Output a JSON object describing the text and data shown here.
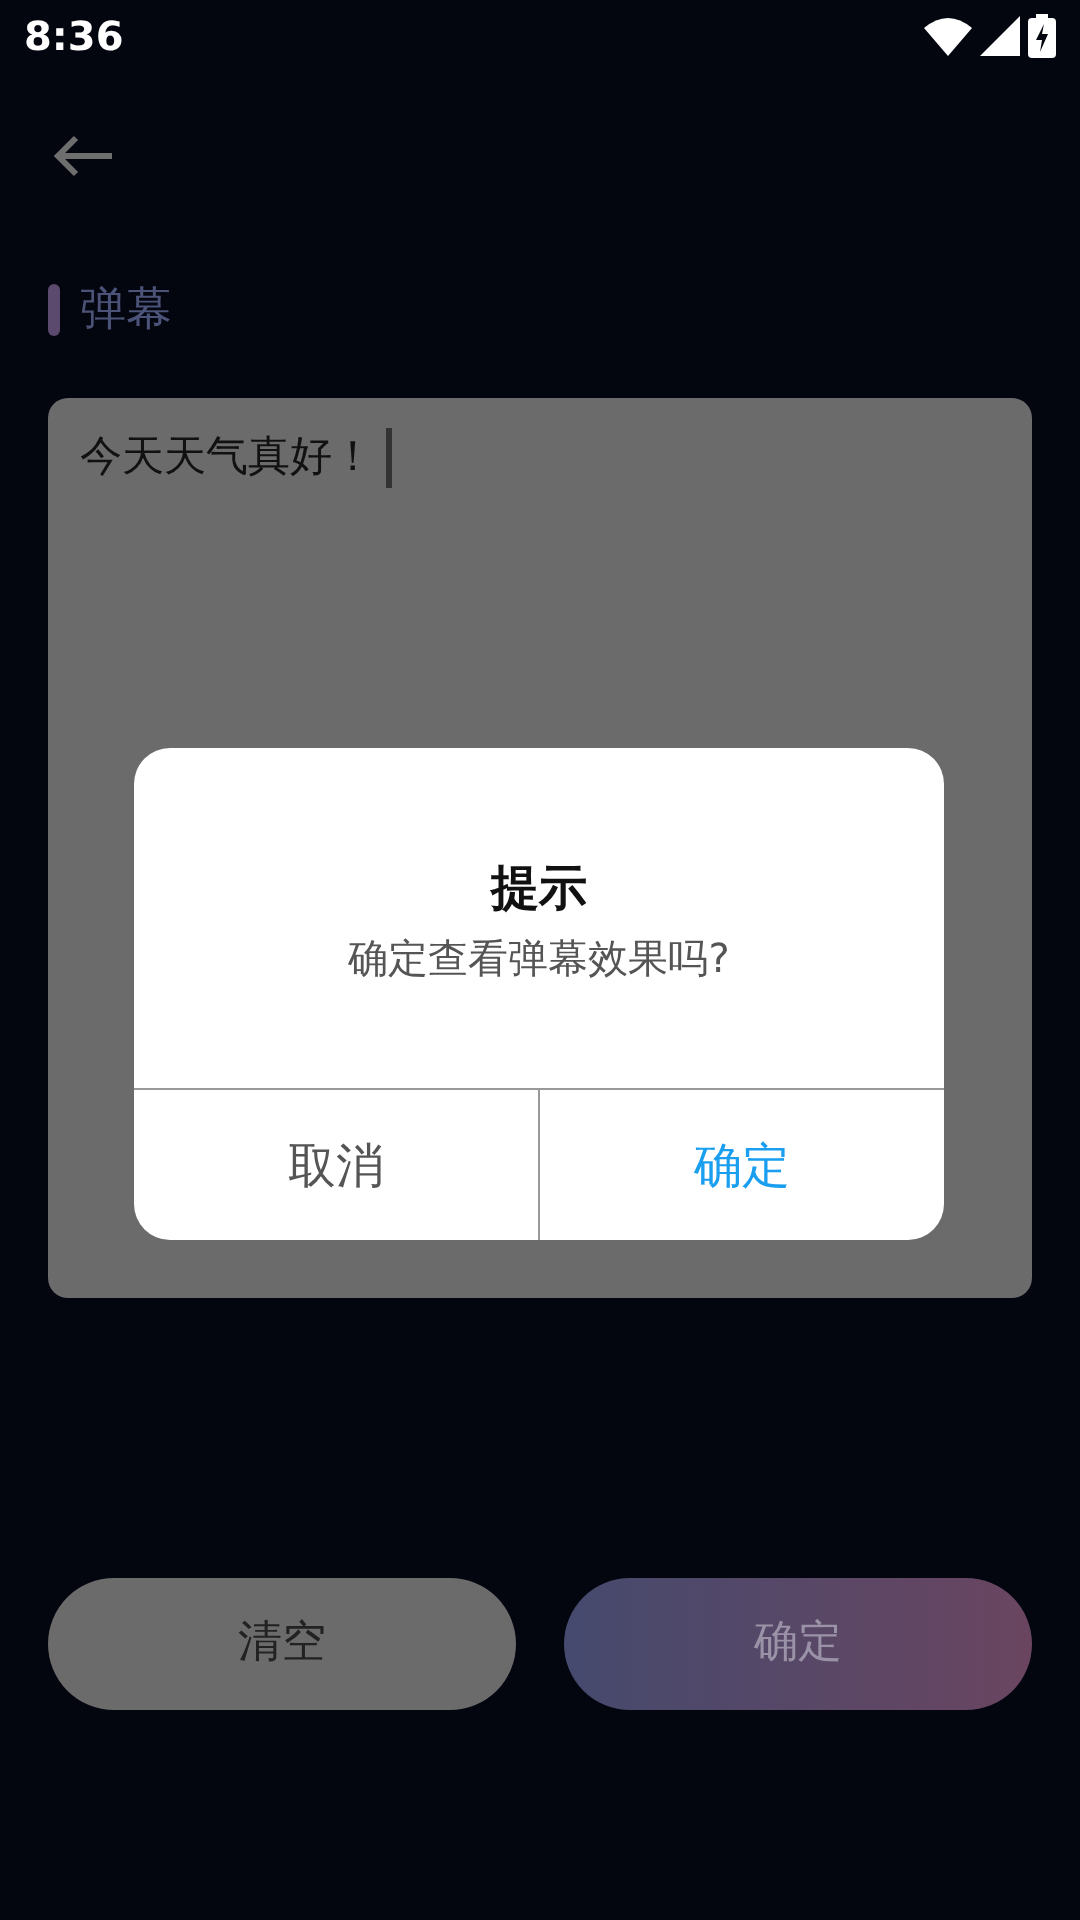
{
  "status_bar": {
    "time": "8:36"
  },
  "section": {
    "title": "弹幕"
  },
  "message": {
    "value": "今天天气真好！",
    "focused": true
  },
  "buttons": [
    {
      "label": "清空",
      "kind": "plain"
    },
    {
      "label": "确定",
      "kind": "gradient"
    }
  ],
  "dialog": {
    "title": "提示",
    "message": "确定查看弹幕效果吗?",
    "actions": [
      {
        "label": "取消",
        "primary": false
      },
      {
        "label": "确定",
        "primary": true
      }
    ]
  }
}
